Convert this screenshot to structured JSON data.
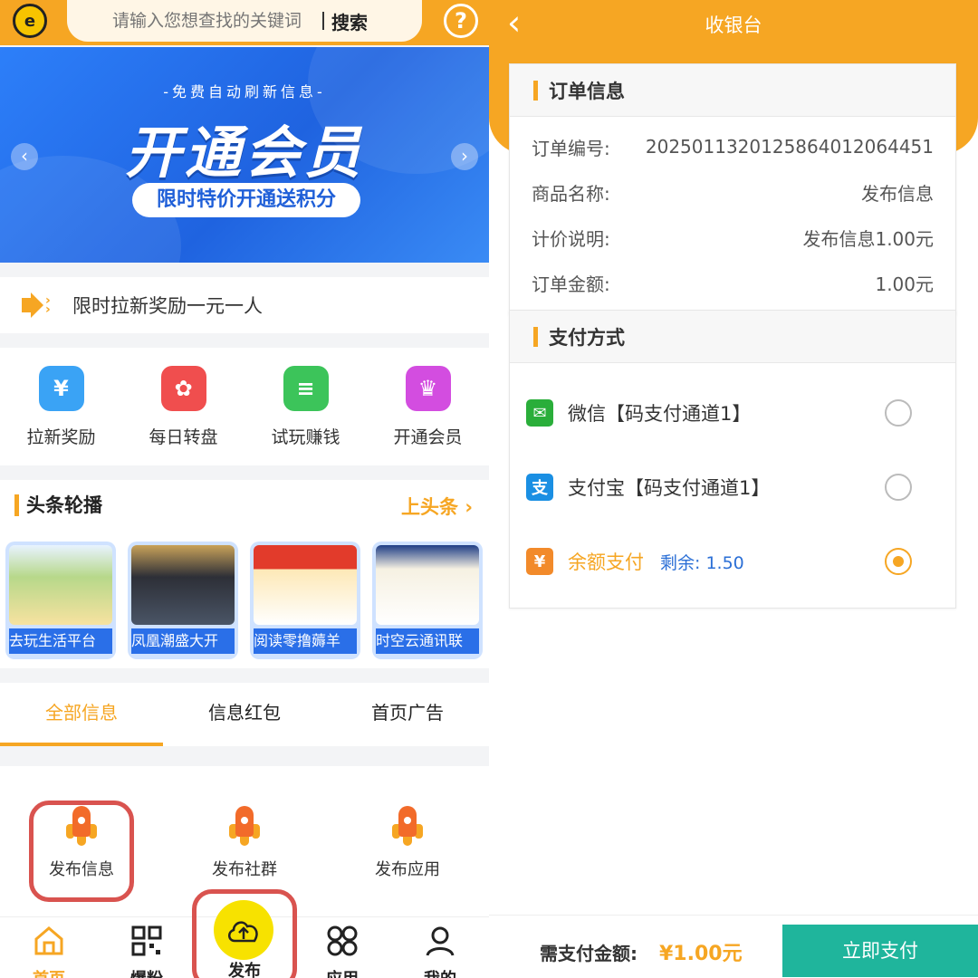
{
  "left": {
    "search": {
      "placeholder": "请输入您想查找的关键词",
      "button": "搜索"
    },
    "banner": {
      "subtitle": "-免费自动刷新信息-",
      "title": "开通会员",
      "pill": "限时特价开通送积分"
    },
    "notice": {
      "text": "限时拉新奖励一元一人"
    },
    "grid": [
      {
        "label": "拉新奖励",
        "icon": "money-bag-icon",
        "color": "#3aa3f5",
        "glyph": "¥"
      },
      {
        "label": "每日转盘",
        "icon": "wheel-icon",
        "color": "#f04e4e",
        "glyph": "✿"
      },
      {
        "label": "试玩赚钱",
        "icon": "coins-icon",
        "color": "#3cc45a",
        "glyph": "≡"
      },
      {
        "label": "开通会员",
        "icon": "crown-icon",
        "color": "#d34de0",
        "glyph": "♛"
      }
    ],
    "headline": {
      "title": "头条轮播",
      "more": "上头条",
      "cards": [
        {
          "label": "去玩生活平台"
        },
        {
          "label": "凤凰潮盛大开"
        },
        {
          "label": "阅读零撸薅羊"
        },
        {
          "label": "时空云通讯联"
        }
      ]
    },
    "tabs": [
      "全部信息",
      "信息红包",
      "首页广告"
    ],
    "publish": [
      "发布信息",
      "发布社群",
      "发布应用"
    ],
    "nav": {
      "home": "首页",
      "fans": "爆粉",
      "publish": "发布",
      "apps": "应用",
      "mine": "我的"
    }
  },
  "right": {
    "title": "收银台",
    "order": {
      "section": "订单信息",
      "rows": [
        {
          "label": "订单编号:",
          "value": "2025011320125864012064451"
        },
        {
          "label": "商品名称:",
          "value": "发布信息"
        },
        {
          "label": "计价说明:",
          "value": "发布信息1.00元"
        },
        {
          "label": "订单金额:",
          "value": "1.00元"
        }
      ]
    },
    "payment": {
      "section": "支付方式",
      "methods": [
        {
          "name": "微信【码支付通道1】",
          "icon": "wechat-icon",
          "color": "#2aae3a",
          "glyph": "✉",
          "selected": false
        },
        {
          "name": "支付宝【码支付通道1】",
          "icon": "alipay-icon",
          "color": "#1a8fe3",
          "glyph": "支",
          "selected": false
        },
        {
          "name": "余额支付",
          "sub": "剩余: 1.50",
          "icon": "wallet-icon",
          "color": "#f28a2a",
          "glyph": "¥",
          "selected": true
        }
      ]
    },
    "footer": {
      "due_label": "需支付金额:",
      "due_amount": "¥1.00元",
      "pay_button": "立即支付"
    }
  }
}
